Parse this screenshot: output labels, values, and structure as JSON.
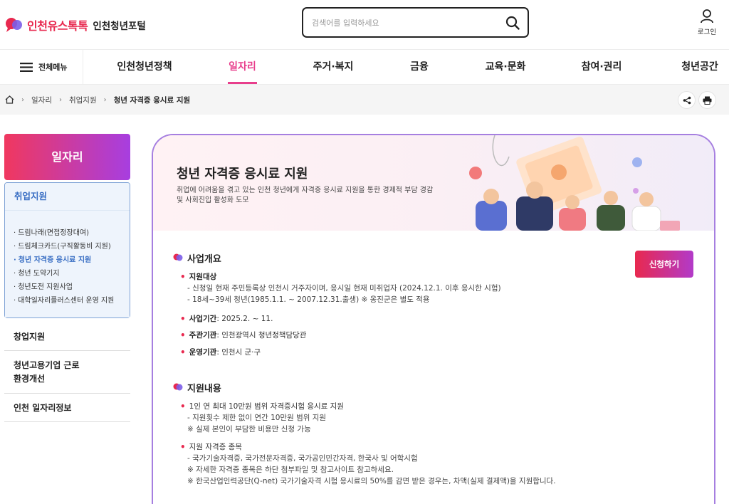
{
  "header": {
    "logo_text": "인천유스톡톡",
    "portal_name": "인천청년포털",
    "search_placeholder": "검색어를 입력하세요",
    "login_label": "로그인"
  },
  "nav": {
    "all_menu_label": "전체메뉴",
    "items": [
      {
        "label": "인천청년정책",
        "active": false
      },
      {
        "label": "일자리",
        "active": true
      },
      {
        "label": "주거·복지",
        "active": false
      },
      {
        "label": "금융",
        "active": false
      },
      {
        "label": "교육·문화",
        "active": false
      },
      {
        "label": "참여·권리",
        "active": false
      },
      {
        "label": "청년공간",
        "active": false
      }
    ]
  },
  "breadcrumb": {
    "items": [
      "일자리",
      "취업지원",
      "청년 자격증 응시료 지원"
    ]
  },
  "sidebar": {
    "title": "일자리",
    "active_group": "취업지원",
    "sub_items": [
      {
        "label": "드림나래(면접정장대여)",
        "active": false
      },
      {
        "label": "드림체크카드(구직활동비 지원)",
        "active": false
      },
      {
        "label": "청년 자격증 응시료 지원",
        "active": true
      },
      {
        "label": "청년 도약기지",
        "active": false
      },
      {
        "label": "청년도전 지원사업",
        "active": false
      },
      {
        "label": "대학일자리플러스센터 운영 지원",
        "active": false
      }
    ],
    "menus": [
      {
        "label": "창업지원"
      },
      {
        "label": "청년고용기업 근로환경개선"
      },
      {
        "label": "인천 일자리정보"
      }
    ]
  },
  "page": {
    "title": "청년 자격증 응시료 지원",
    "desc_line1": "취업에 어려움을 겪고 있는 인천 청년에게 자격증 응시료 지원을 통한 경제적 부담 경감",
    "desc_line2": "및 사회진입 활성화 도모",
    "apply_label": "신청하기"
  },
  "overview": {
    "title": "사업개요",
    "target_label": "지원대상",
    "target_lines": [
      "- 신청일 현재 주민등록상 인천시 거주자이며, 응시일 현재 미취업자 (2024.12.1. 이후 응시한 시험)",
      "- 18세~39세 청년(1985.1.1. ~ 2007.12.31.출생) ※ 옹진군은 별도 적용"
    ],
    "period_label": "사업기간",
    "period_value": " : 2025.2. ~ 11.",
    "org_label": "주관기관",
    "org_value": " : 인천광역시 청년정책담당관",
    "op_label": "운영기관",
    "op_value": " : 인천시 군·구"
  },
  "support": {
    "title": "지원내용",
    "item1_title": "1인 연 최대 10만원 범위 자격증시험 응시료 지원",
    "item1_lines": [
      "- 지원횟수 제한 없이 연간 10만원 범위 지원",
      "※ 실제 본인이 부담한 비용만 신청 가능"
    ],
    "item2_title": "지원 자격증 종목",
    "item2_lines": [
      "- 국가기술자격증, 국가전문자격증, 국가공인민간자격, 한국사 및 어학시험",
      "※ 자세한 자격증 종목은 하단 첨부파일 및 참고사이트 참고하세요.",
      "※ 한국산업인력공단(Q-net) 국가기술자격 시험 응시료의 50%를 감면 받은 경우는, 차액(실제 결제액)을 지원합니다."
    ]
  },
  "colors": {
    "brand_pink": "#e8294f",
    "brand_purple": "#a73ee0",
    "nav_active": "#e83e8c",
    "side_active": "#3a6fc4"
  }
}
